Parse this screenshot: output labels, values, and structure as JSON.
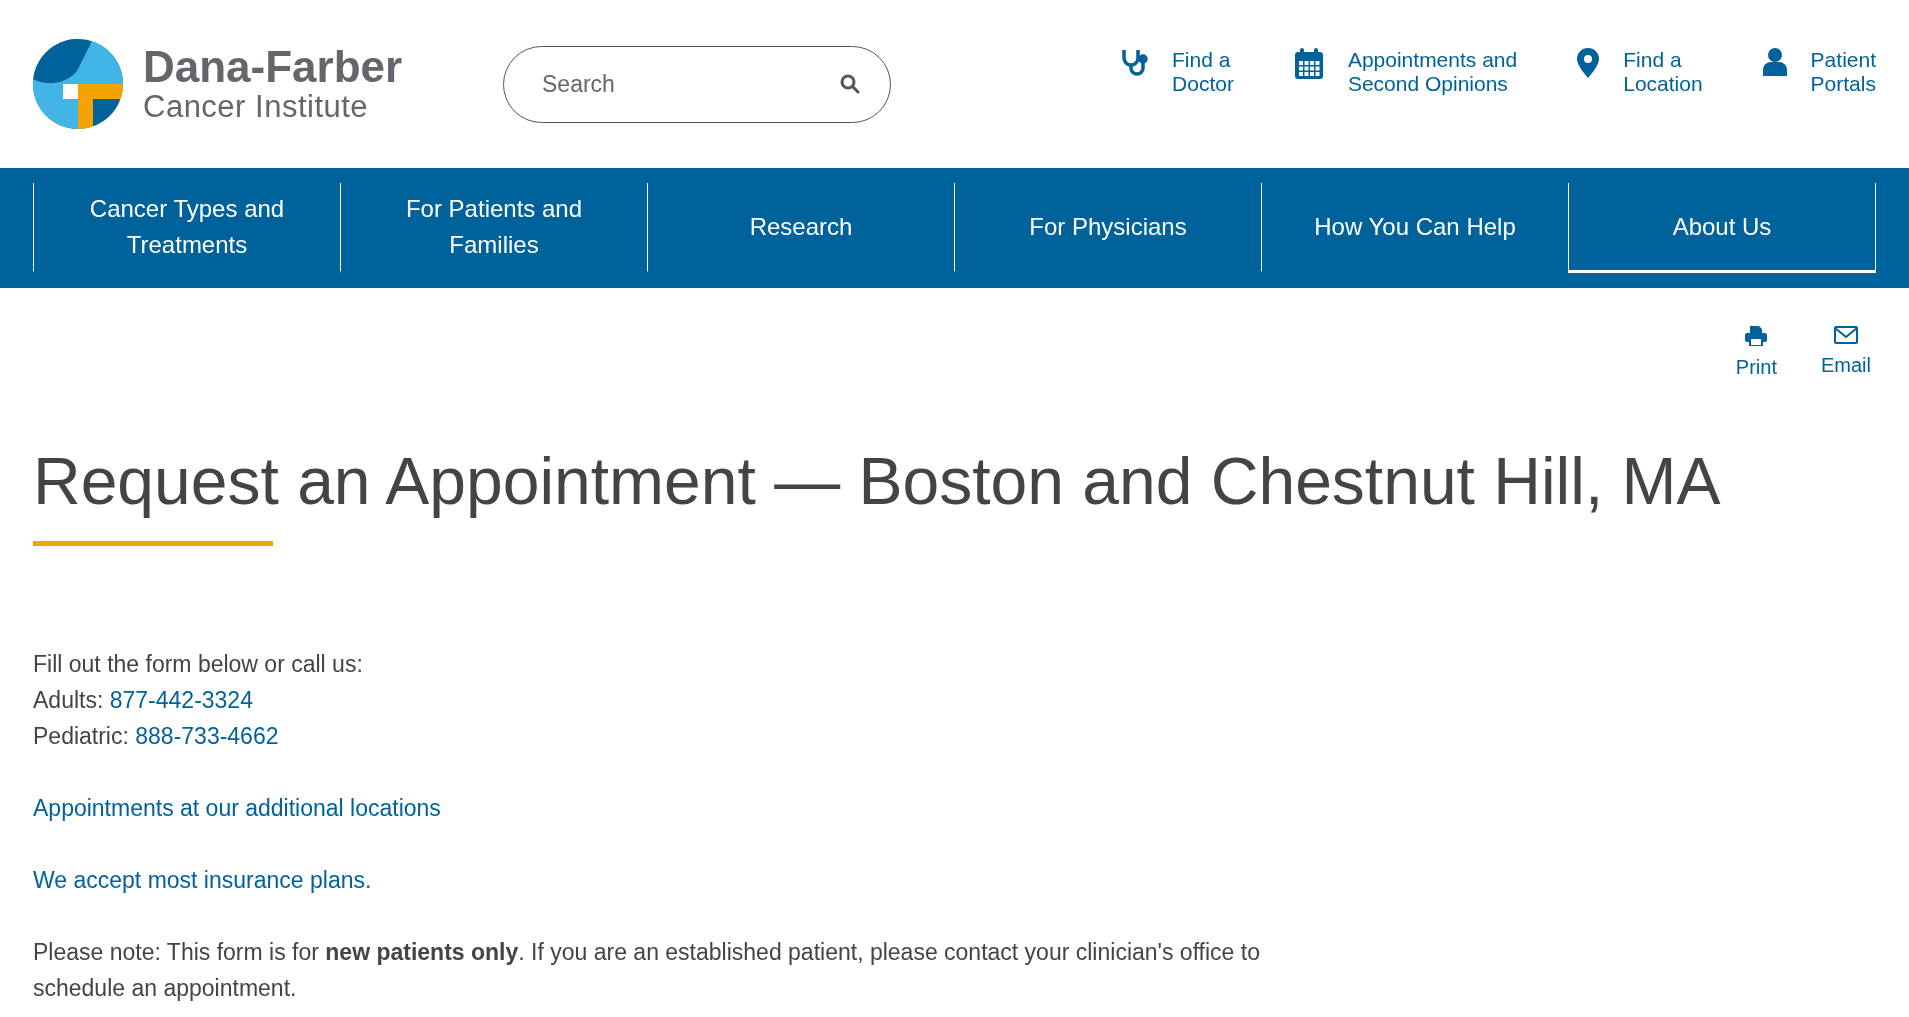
{
  "logo": {
    "name": "Dana-Farber",
    "subtitle": "Cancer Institute"
  },
  "search": {
    "placeholder": "Search"
  },
  "utility_links": [
    {
      "kind": "doctor",
      "lines": [
        "Find a",
        "Doctor"
      ]
    },
    {
      "kind": "calendar",
      "lines": [
        "Appointments and",
        "Second Opinions"
      ]
    },
    {
      "kind": "location",
      "lines": [
        "Find a",
        "Location"
      ]
    },
    {
      "kind": "portal",
      "lines": [
        "Patient",
        "Portals"
      ]
    }
  ],
  "nav": [
    {
      "label": "Cancer Types and Treatments",
      "selected": false
    },
    {
      "label": "For Patients and Families",
      "selected": false
    },
    {
      "label": "Research",
      "selected": false
    },
    {
      "label": "For Physicians",
      "selected": false
    },
    {
      "label": "How You Can Help",
      "selected": false
    },
    {
      "label": "About Us",
      "selected": true
    }
  ],
  "page_tools": [
    {
      "kind": "print",
      "label": "Print"
    },
    {
      "kind": "email",
      "label": "Email"
    }
  ],
  "heading": "Request an Appointment — Boston and Chestnut Hill, MA",
  "intro": "Fill out the form below or call us:",
  "phones": [
    {
      "label": "Adults:",
      "number": "877-442-3324"
    },
    {
      "label": "Pediatric:",
      "number": "888-733-4662"
    }
  ],
  "links": [
    "Appointments at our additional locations",
    "We accept most insurance plans."
  ],
  "note": "Please note: This form is for **new patients only**. If you are an established patient, please contact your clinician's office to schedule an appointment."
}
